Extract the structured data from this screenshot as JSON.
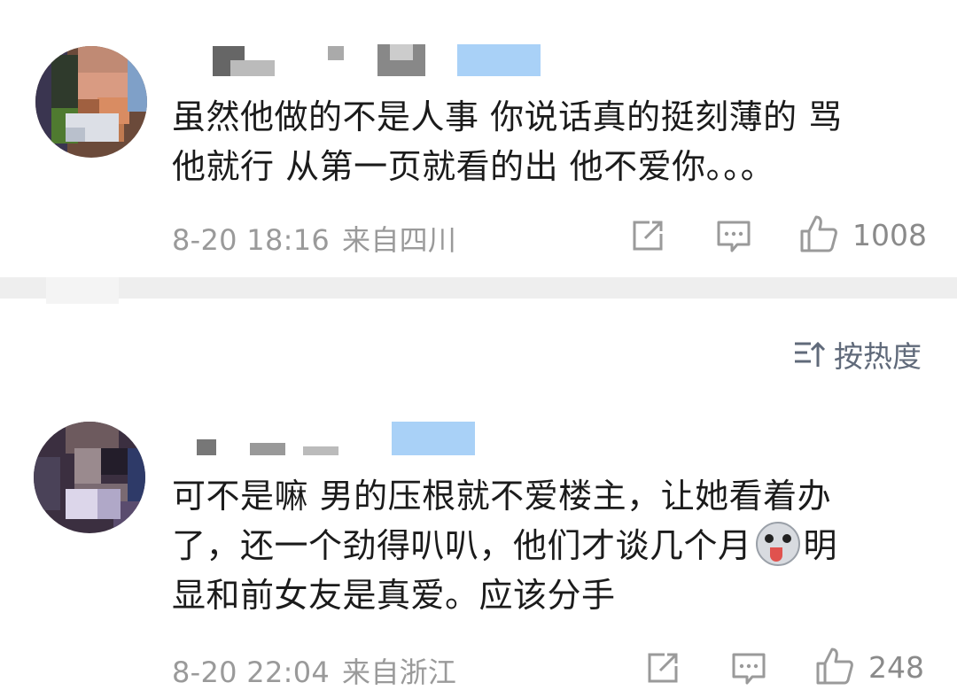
{
  "comments": [
    {
      "text_line1": "虽然他做的不是人事 你说话真的挺刻薄的 骂",
      "text_line2": "他就行 从第一页就看的出 他不爱你。。。",
      "date": "8-20 18:16",
      "location": "来自四川",
      "likes": "1008"
    },
    {
      "text_line1": "可不是嘛 男的压根就不爱楼主，让她看着办",
      "text_line2a": "了，还一个劲得叭叭，他们才谈几个月",
      "text_line2b": "明",
      "text_line3": "显和前女友是真爱。应该分手",
      "date": "8-20 22:04",
      "location": "来自浙江",
      "likes": "248"
    }
  ],
  "sort": {
    "label": "按热度",
    "icon": "sort-icon"
  },
  "icons": [
    "repost-icon",
    "comment-icon",
    "like-icon",
    "husky-emoji-icon"
  ],
  "colors": {
    "text": "#1b1b1b",
    "meta": "#9a9a9a",
    "sort": "#606a7a",
    "divider": "#eeeeee",
    "name_blur_blue": "#a9d1f7"
  }
}
